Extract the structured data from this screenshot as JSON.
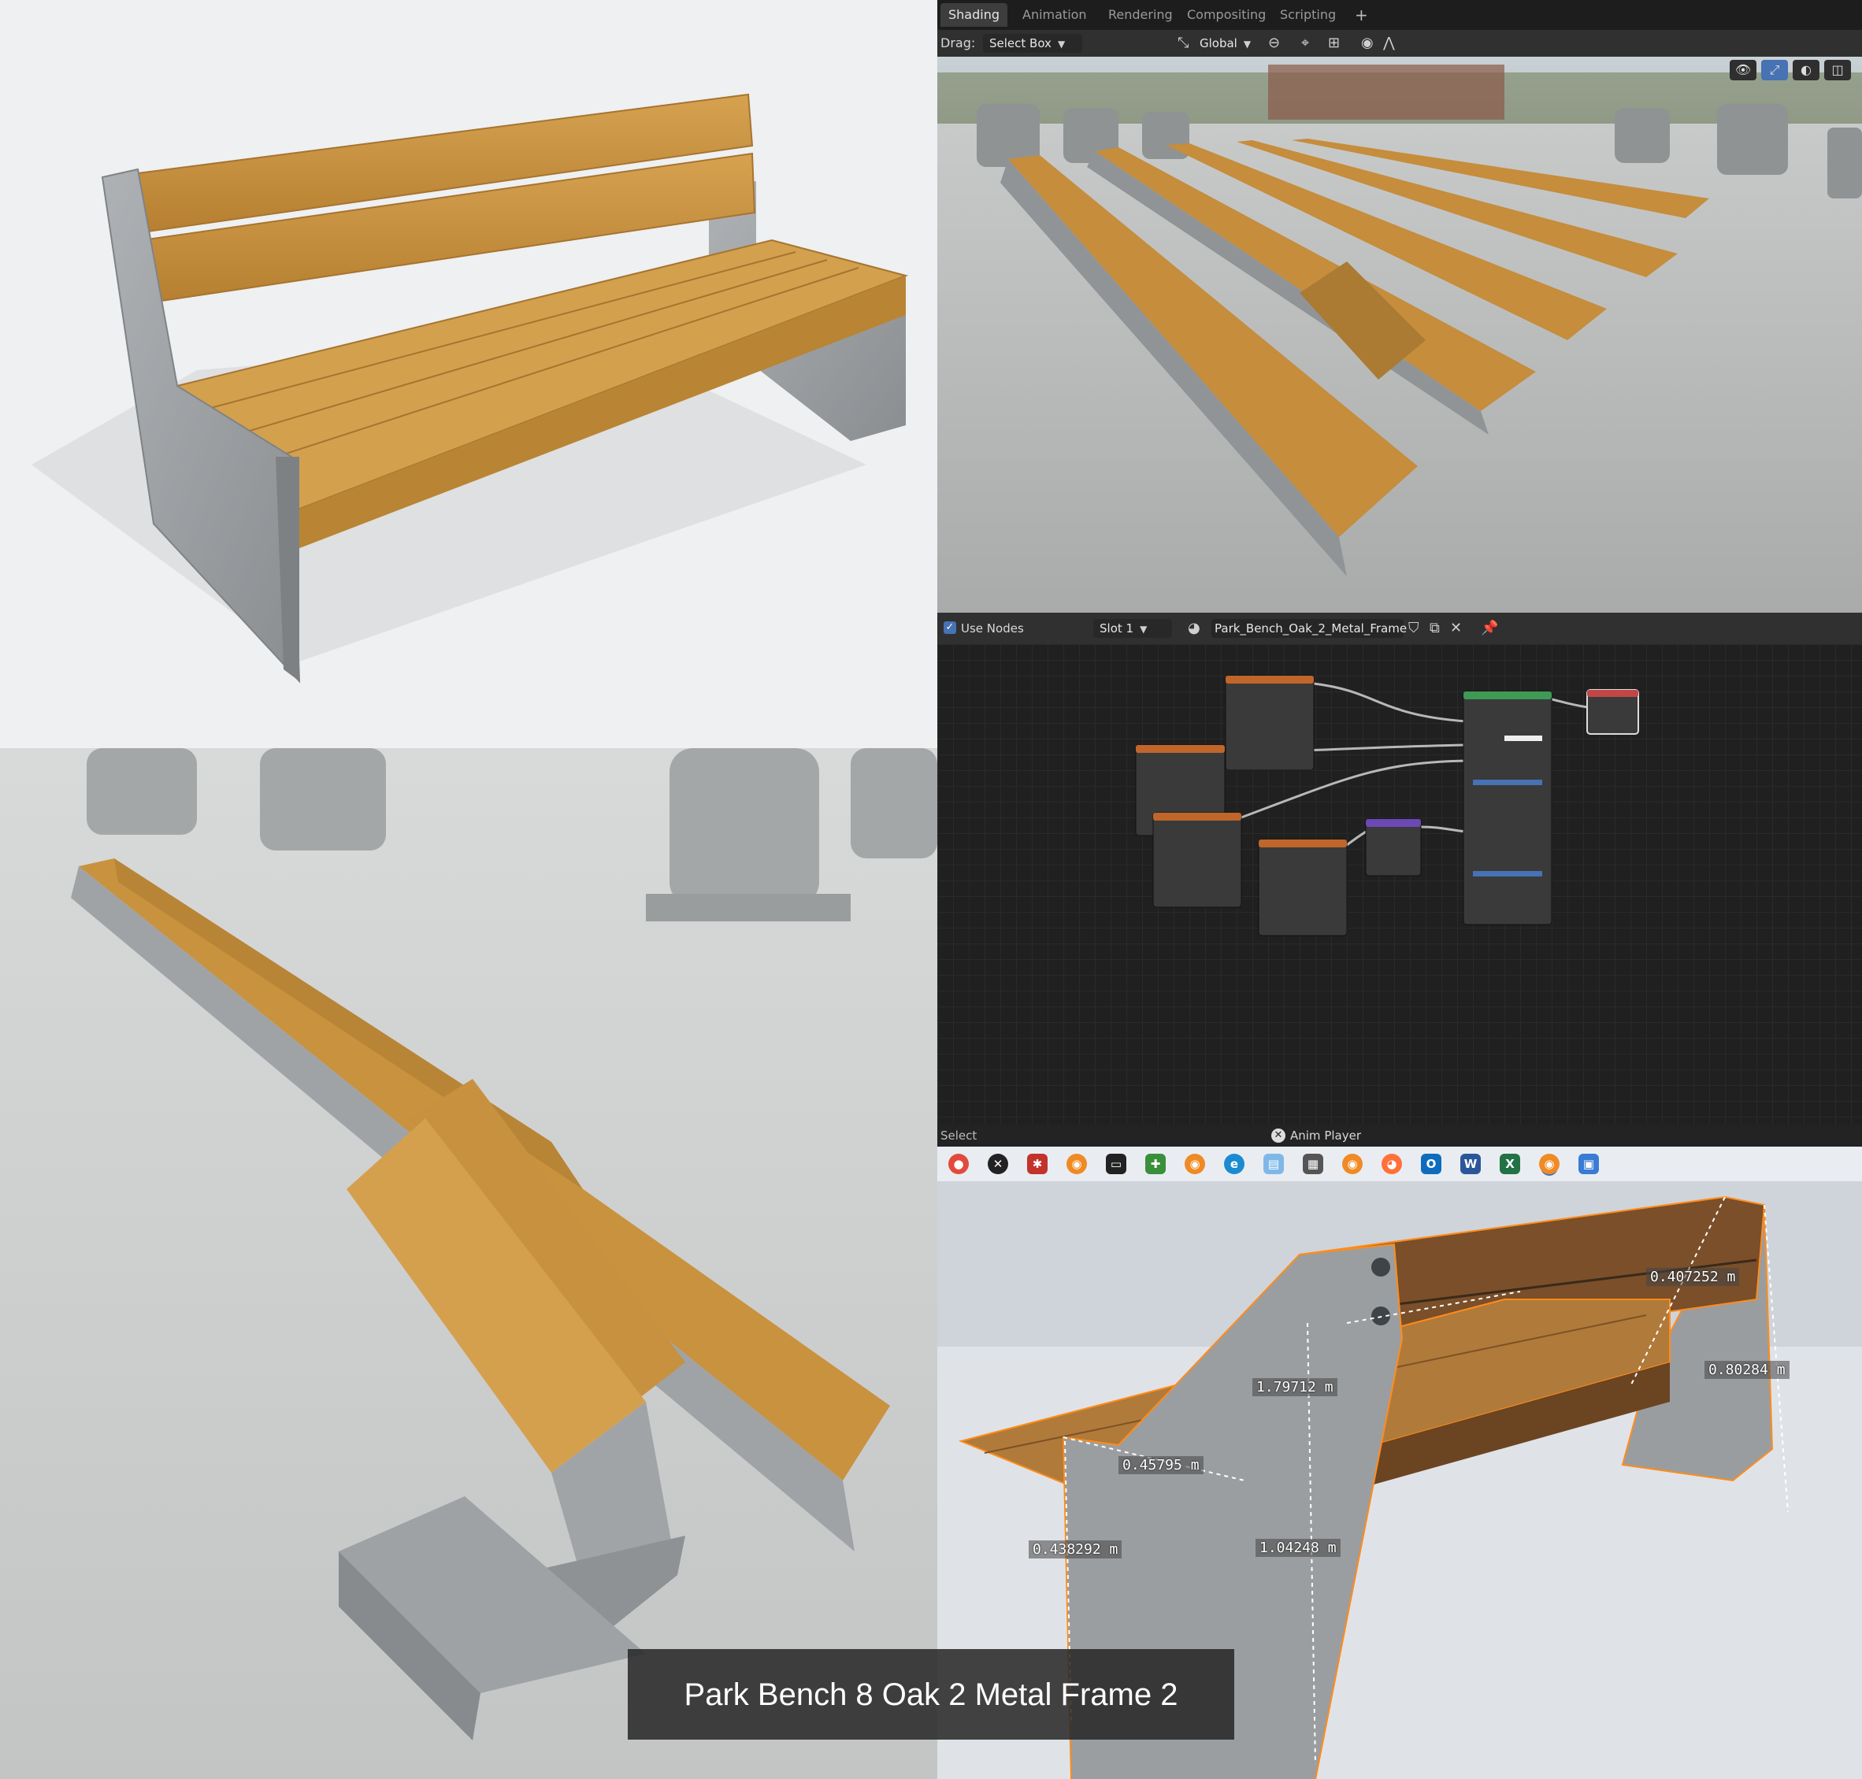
{
  "workspace_tabs": [
    "Shading",
    "Animation",
    "Rendering",
    "Compositing",
    "Scripting"
  ],
  "add_tab_icon": "plus-icon",
  "toolbar": {
    "drag_label": "Drag:",
    "drag_mode": "Select Box",
    "orientation": "Global"
  },
  "node_header": {
    "use_nodes_label": "Use Nodes",
    "slot": "Slot 1",
    "material_name": "Park_Bench_Oak_2_Metal_Frame"
  },
  "status": {
    "left": "Select",
    "anim_player": "Anim Player"
  },
  "caption": "Park Bench 8 Oak 2 Metal Frame 2",
  "measurements": [
    "0.407252 m",
    "1.79712 m",
    "0.80284 m",
    "0.45795 m",
    "0.438292 m",
    "1.04248 m"
  ],
  "taskbar_icons": [
    "chrome-icon",
    "xbox-icon",
    "puzzle-icon",
    "blender-icon",
    "terminal-icon",
    "editor-icon",
    "blender-icon",
    "edge-icon",
    "notes-icon",
    "calculator-icon",
    "blender-icon",
    "firefox-icon",
    "outlook-icon",
    "word-icon",
    "excel-icon",
    "blender-icon",
    "screenshot-icon"
  ],
  "colors": {
    "wood": "#c9923f",
    "metal": "#9ea2a5",
    "blender_accent": "#4772b3",
    "node_texture_header": "#c0662a",
    "node_shader_header": "#3f9a56",
    "node_output_header": "#c24646"
  }
}
